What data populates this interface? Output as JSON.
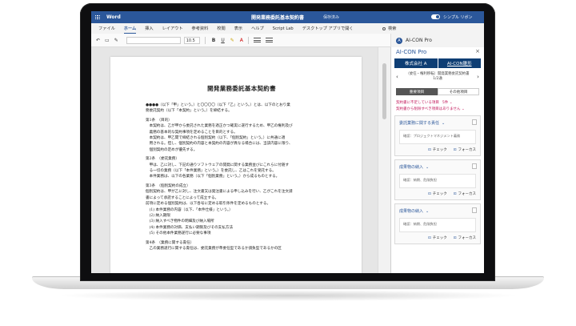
{
  "window": {
    "app_name": "Word",
    "doc_title": "開発業務委託基本契約書",
    "save_status": "保存済み",
    "simple_ribbon": "シンプル リボン"
  },
  "menu": {
    "items": [
      "ファイル",
      "ホーム",
      "挿入",
      "レイアウト",
      "参考資料",
      "校閲",
      "表示",
      "ヘルプ",
      "Script Lab",
      "デスクトップ アプリで開く"
    ],
    "active": "ホーム",
    "search": "検索"
  },
  "ribbon": {
    "font_size": "10.5",
    "bold": "B",
    "underline": "U",
    "more": "…"
  },
  "addin_header": "AI-CON Pro",
  "document": {
    "title": "開発業務委託基本契約書",
    "lines": [
      "●●●●（以下「甲」という。）と〇〇〇〇（以下「乙」という。）とは、以下のとおり業",
      "務委託契約（以下「本契約」という。）を締結する。",
      "",
      "第1条　（目的）",
      "　本契約は、乙が甲から委託された業務を適正かつ確実に遂行するため、甲乙の権利及び",
      "　義務の基本的な契約事項を定めることを目的とする。",
      "　本契約は、甲乙間で締結される個別契約（以下、「個別契約」という。）に共通に適",
      "　用される。但し、個別契約の内容と本契約の内容が異なる場合には、当該内容に限り、",
      "　個別契約の定めが優先する。",
      "",
      "第2条　（委託業務）",
      "　甲は、乙に対し、下記の通りソフトウェアの開発に関する業務並びにこれらに付随す",
      "　る一切の業務（以下「本件業務」という。）を委託し、乙はこれを受託する。",
      "　本件業務は、以下の各業務（以下「個別業務」という。）から成るものとする。",
      "",
      "第3条　（個別契約の成立）",
      "個別契約は、甲が乙に対し、注文書又は発注書による申し込みを行い、乙がこれを注文請",
      "書によって承諾することによって成立する。",
      "前項に定める個別契約は、以下各号に定める取引条件を定めるものとする。",
      "　(1) 本件業務の内容（以下、「本件仕様」という。）",
      "　(2) 納入期限",
      "　(3) 納入すべき物件の明細及び納入場所",
      "　(4) 本件業務の対価、支払い期限及びその支払方法",
      "　(5) その他本件業務遂行に必要な事項",
      "",
      "第4条　（業務に関する責任）",
      "　乙の業務遂行に関する責任は、委託業務が準委任型であるか請負型であるかの区"
    ]
  },
  "panel": {
    "title": "AI-CON Pro",
    "company": "株式会社 A",
    "template": "AI-CON雛形",
    "nav_text": "（委任・権利移転）開発業務委託契約書",
    "nav_count": "1/2通",
    "tabs": [
      "重要項目",
      "その他項目"
    ],
    "active_tab": "重要項目",
    "alerts": [
      {
        "text": "契約書に不足している項目",
        "count": "5件"
      },
      {
        "text": "契約書から削除すべき項目はありません",
        "count": ""
      }
    ],
    "cards": [
      {
        "title": "委託業務に関する責任",
        "body": "確認：プロジェクトマネジメント義務",
        "check": "チェック",
        "focus": "フォーカス"
      },
      {
        "title": "成果物の納入",
        "body": "確認：納期、危険負担",
        "check": "チェック",
        "focus": "フォーカス"
      },
      {
        "title": "成果物の納入",
        "body": "確認：納期、危険負担",
        "check": "チェック",
        "focus": "フォーカス"
      }
    ]
  }
}
